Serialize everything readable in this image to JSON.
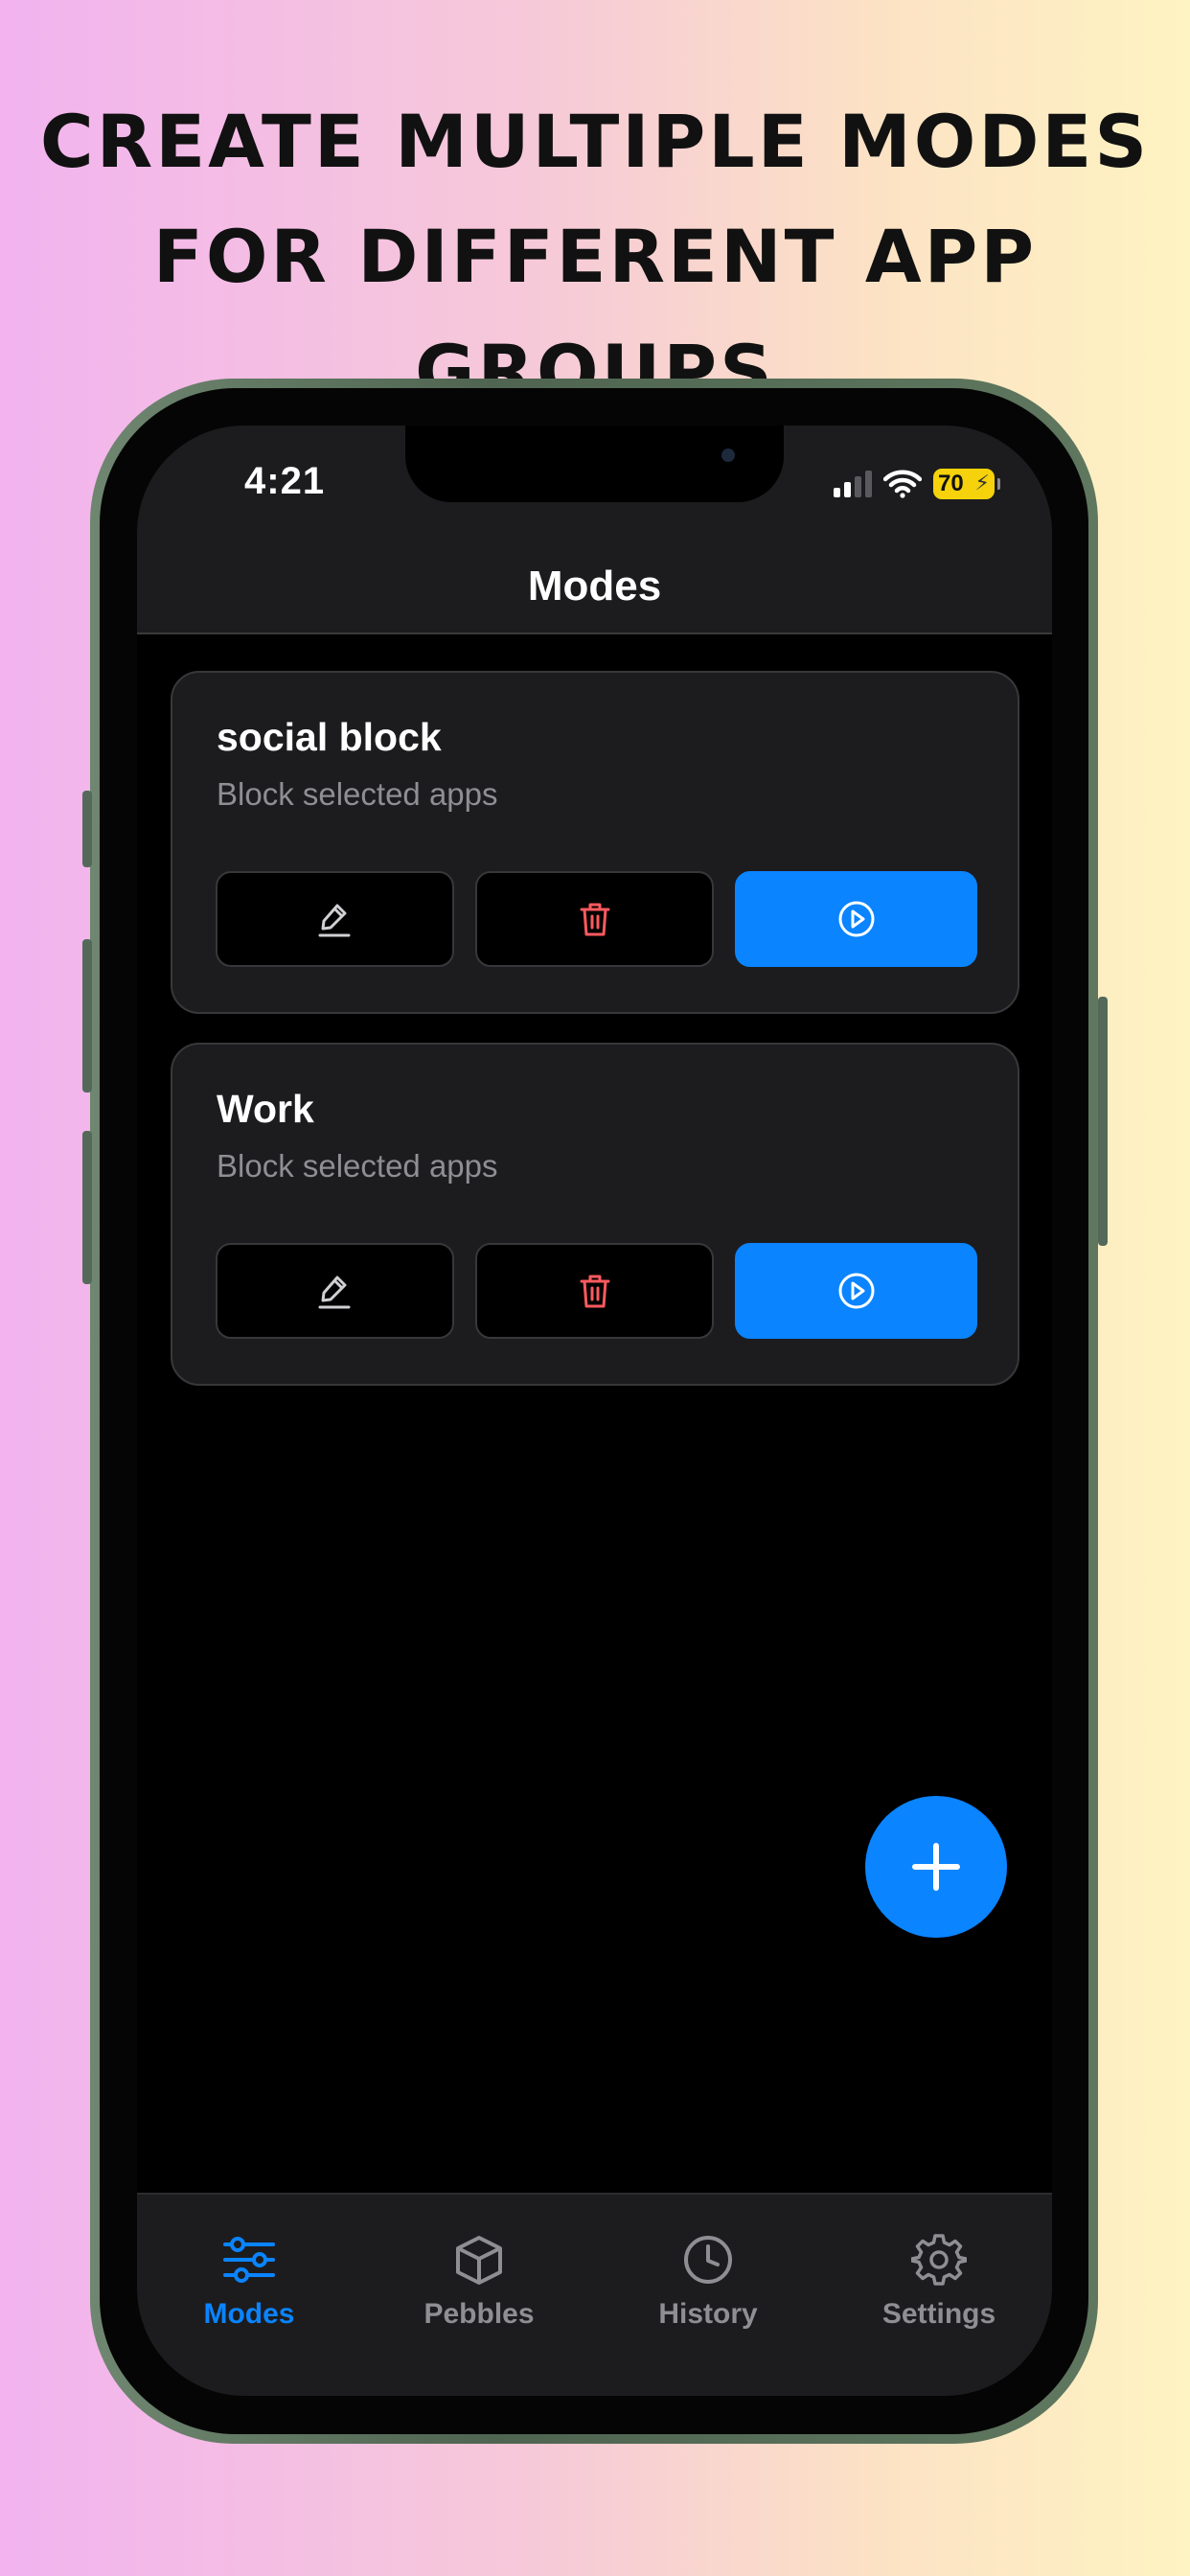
{
  "headline": {
    "line1": "CREATE MULTIPLE MODES",
    "line2": "FOR DIFFERENT APP GROUPS"
  },
  "status_bar": {
    "time": "4:21",
    "battery": "70",
    "signal_icon": "cellular-signal-icon",
    "wifi_icon": "wifi-icon"
  },
  "nav": {
    "title": "Modes"
  },
  "modes": [
    {
      "name": "social block",
      "description": "Block selected apps"
    },
    {
      "name": "Work",
      "description": "Block selected apps"
    }
  ],
  "actions": {
    "edit_icon": "pencil-icon",
    "delete_icon": "trash-icon",
    "run_icon": "play-circle-icon"
  },
  "fab": {
    "icon": "plus-icon"
  },
  "tabs": [
    {
      "label": "Modes",
      "icon": "sliders-icon",
      "active": true
    },
    {
      "label": "Pebbles",
      "icon": "cube-icon",
      "active": false
    },
    {
      "label": "History",
      "icon": "clock-icon",
      "active": false
    },
    {
      "label": "Settings",
      "icon": "gear-icon",
      "active": false
    }
  ],
  "colors": {
    "accent": "#0a84ff",
    "delete": "#ff5a5f",
    "battery": "#f5d20b",
    "card": "#1c1c1e"
  }
}
